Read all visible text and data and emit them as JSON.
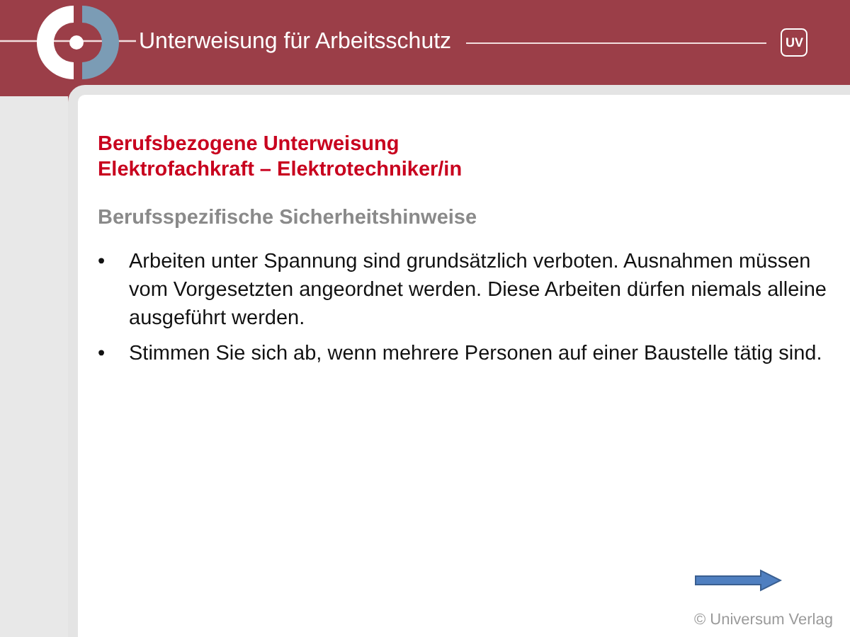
{
  "header": {
    "title": "Unterweisung für Arbeitsschutz",
    "badge": "UV"
  },
  "slide": {
    "heading_lines": [
      "Berufsbezogene Unterweisung",
      "Elektrofachkraft – Elektrotechniker/in"
    ],
    "subheading": "Berufsspezifische Sicherheitshinweise",
    "bullets": [
      {
        "marker": "•",
        "text": "Arbeiten unter Spannung sind grundsätzlich verboten. Ausnahmen müssen vom Vorgesetzten angeordnet werden. Diese Arbeiten dürfen niemals alleine ausgeführt werden."
      },
      {
        "marker": "•",
        "text": "Stimmen Sie sich ab, wenn mehrere Personen auf einer Baustelle tätig sind."
      }
    ]
  },
  "footer": {
    "copyright": "© Universum Verlag"
  }
}
